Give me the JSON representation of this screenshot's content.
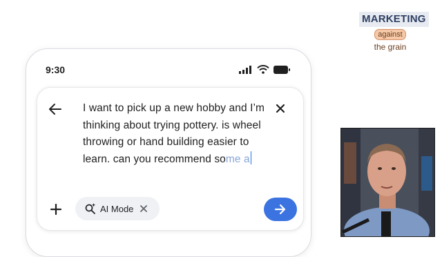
{
  "status_bar": {
    "time": "9:30"
  },
  "search": {
    "query_main": "I want to pick up a new hobby and I’m thinking about trying pottery. is wheel throwing or hand building easier to learn. can you recommend so",
    "query_fade": "me a"
  },
  "chip": {
    "label": "AI Mode",
    "icon": "sparkle-search-icon"
  },
  "logo": {
    "line1": "MARKETING",
    "line2": "against",
    "line3": "the grain"
  },
  "colors": {
    "send": "#3b73e0",
    "chip_bg": "#eff1f4",
    "accent_caret": "#1a73e8"
  }
}
